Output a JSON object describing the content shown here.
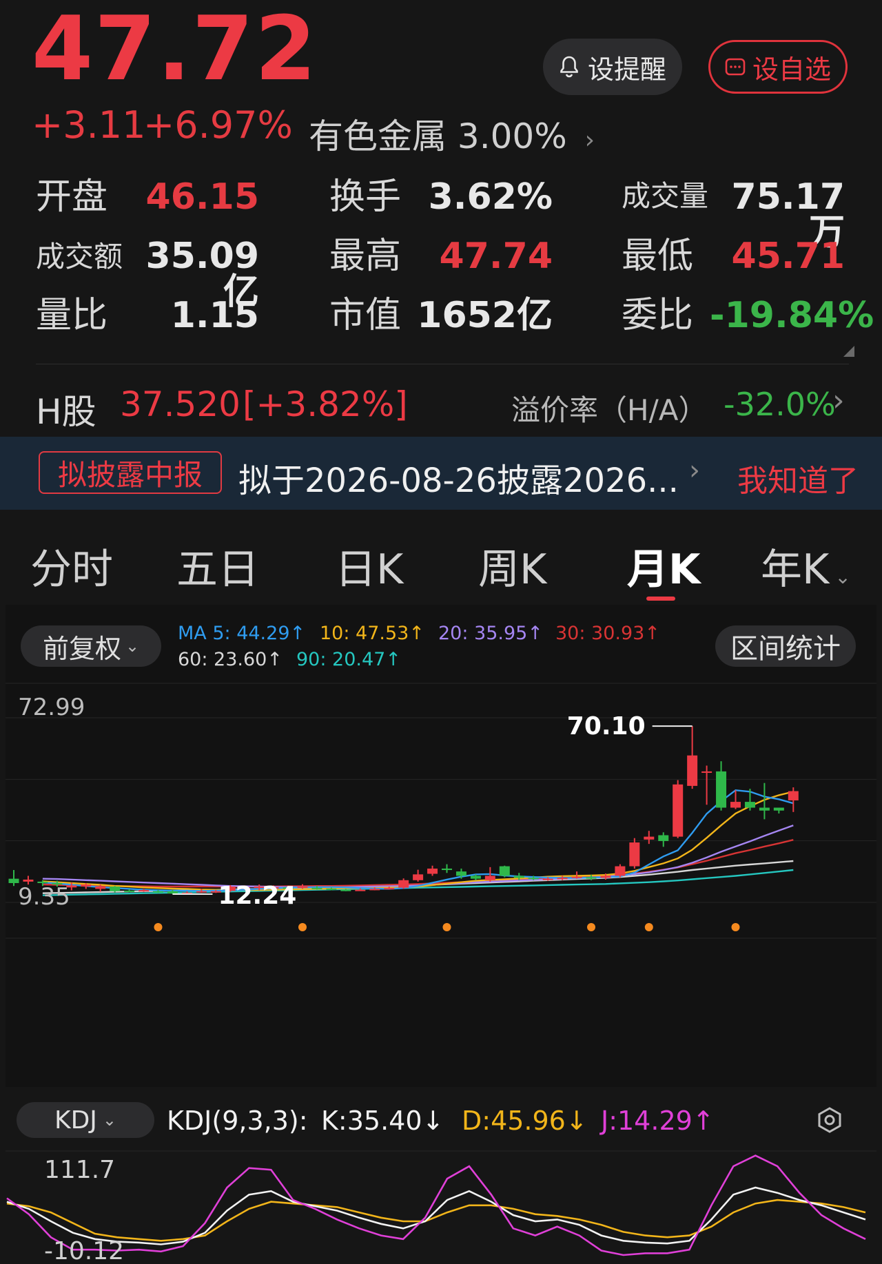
{
  "header": {
    "price": "47.72",
    "change": "+3.11",
    "change_pct": "+6.97%",
    "sector": "有色金属 3.00%",
    "alert_label": "设提醒",
    "watch_label": "设自选"
  },
  "stats": [
    {
      "label": "开盘",
      "value": "46.15",
      "color": "red"
    },
    {
      "label": "换手",
      "value": "3.62%",
      "color": "white"
    },
    {
      "label": "成交量",
      "value": "75.17万",
      "color": "white"
    },
    {
      "label": "成交额",
      "value": "35.09亿",
      "color": "white"
    },
    {
      "label": "最高",
      "value": "47.74",
      "color": "red"
    },
    {
      "label": "最低",
      "value": "45.71",
      "color": "red"
    },
    {
      "label": "量比",
      "value": "1.15",
      "color": "white"
    },
    {
      "label": "市值",
      "value": "1652亿",
      "color": "white"
    },
    {
      "label": "委比",
      "value": "-19.84%",
      "color": "green"
    }
  ],
  "hshare": {
    "label": "H股",
    "price": "37.520",
    "change": "[+3.82%]",
    "premium_label": "溢价率（H/A）",
    "premium_value": "-32.0%"
  },
  "banner": {
    "tag": "拟披露中报",
    "text": "拟于2026-08-26披露2026...",
    "ack": "我知道了"
  },
  "tabs": [
    {
      "label": "分时",
      "active": false
    },
    {
      "label": "五日",
      "active": false
    },
    {
      "label": "日K",
      "active": false
    },
    {
      "label": "周K",
      "active": false
    },
    {
      "label": "月K",
      "active": true
    },
    {
      "label": "年K",
      "active": false
    }
  ],
  "chart_toolbar": {
    "adjust_label": "前复权",
    "stats_label": "区间统计",
    "ma": [
      {
        "text": "MA 5: 44.29↑",
        "color": "#2f9cf0"
      },
      {
        "text": "10: 47.53↑",
        "color": "#f2b51a"
      },
      {
        "text": "20: 35.95↑",
        "color": "#a586f2"
      },
      {
        "text": "30: 30.93↑",
        "color": "#d83434"
      },
      {
        "text": "60: 23.60↑",
        "color": "#d8d8d8"
      },
      {
        "text": "90: 20.47↑",
        "color": "#25c7c0"
      }
    ]
  },
  "chart_data": {
    "type": "candlestick",
    "y_top_label": "72.99",
    "y_bottom_label": "9.35",
    "ylim": [
      9.35,
      72.99
    ],
    "high_marker": "70.10",
    "low_marker": "12.24",
    "candles": [
      [
        17.5,
        16.0,
        20.5,
        15.0
      ],
      [
        16.5,
        17.2,
        18.5,
        15.5
      ],
      [
        16.5,
        16.0,
        17.0,
        15.0
      ],
      [
        16.0,
        15.5,
        16.8,
        14.8
      ],
      [
        14.5,
        15.2,
        16.2,
        13.5
      ],
      [
        14.8,
        15.5,
        16.0,
        14.0
      ],
      [
        14.0,
        14.8,
        15.5,
        13.0
      ],
      [
        14.8,
        13.2,
        15.0,
        12.8
      ],
      [
        13.4,
        13.3,
        13.9,
        12.8
      ],
      [
        13.4,
        13.6,
        14.0,
        13.0
      ],
      [
        13.2,
        13.1,
        13.6,
        12.6
      ],
      [
        13.2,
        12.4,
        13.6,
        12.2
      ],
      [
        12.6,
        12.7,
        13.2,
        12.3
      ],
      [
        12.8,
        13.2,
        14.0,
        12.6
      ],
      [
        13.0,
        13.2,
        13.6,
        12.6
      ],
      [
        13.3,
        14.8,
        15.3,
        13.0
      ],
      [
        14.3,
        14.5,
        15.2,
        13.8
      ],
      [
        14.3,
        14.8,
        15.5,
        13.5
      ],
      [
        14.4,
        14.6,
        15.2,
        13.7
      ],
      [
        14.5,
        14.1,
        15.0,
        13.8
      ],
      [
        14.6,
        14.8,
        15.6,
        14.0
      ],
      [
        14.4,
        14.1,
        15.0,
        13.8
      ],
      [
        14.1,
        13.7,
        14.5,
        13.5
      ],
      [
        13.7,
        13.6,
        14.0,
        13.2
      ],
      [
        13.6,
        13.7,
        14.2,
        13.3
      ],
      [
        13.8,
        14.0,
        14.5,
        13.5
      ],
      [
        14.0,
        14.3,
        14.8,
        13.8
      ],
      [
        14.4,
        17.0,
        17.6,
        14.0
      ],
      [
        17.0,
        19.0,
        20.6,
        16.5
      ],
      [
        19.2,
        21.0,
        22.0,
        18.5
      ],
      [
        21.0,
        20.5,
        22.5,
        19.5
      ],
      [
        20.0,
        18.5,
        21.0,
        17.5
      ],
      [
        18.5,
        17.5,
        19.0,
        17.0
      ],
      [
        17.0,
        18.5,
        21.5,
        16.5
      ],
      [
        21.8,
        18.5,
        22.0,
        18.0
      ],
      [
        18.5,
        17.8,
        19.5,
        17.0
      ],
      [
        17.8,
        17.5,
        18.5,
        17.0
      ],
      [
        17.2,
        17.5,
        18.0,
        16.8
      ],
      [
        17.5,
        17.8,
        18.5,
        17.0
      ],
      [
        17.8,
        18.2,
        20.0,
        17.5
      ],
      [
        18.0,
        17.5,
        18.8,
        17.0
      ],
      [
        17.8,
        18.5,
        19.3,
        17.2
      ],
      [
        18.5,
        21.8,
        22.5,
        18.0
      ],
      [
        21.8,
        30.0,
        31.5,
        21.0
      ],
      [
        31.0,
        32.0,
        34.0,
        29.5
      ],
      [
        32.5,
        30.5,
        33.5,
        28.5
      ],
      [
        32.0,
        50.0,
        51.5,
        31.5
      ],
      [
        49.5,
        60.0,
        70.1,
        48.5
      ],
      [
        54.0,
        54.5,
        56.5,
        43.0
      ],
      [
        54.5,
        42.0,
        58.0,
        41.0
      ],
      [
        42.0,
        44.0,
        48.0,
        41.5
      ],
      [
        44.0,
        42.0,
        48.5,
        41.0
      ],
      [
        42.0,
        41.0,
        50.5,
        38.0
      ],
      [
        42.0,
        41.0,
        42.0,
        40.0
      ],
      [
        44.5,
        47.7,
        49.0,
        40.5
      ]
    ],
    "ma_series": {
      "ma5": [
        16.2,
        15.9,
        15.4,
        15.0,
        14.6,
        14.3,
        14.0,
        13.7,
        13.5,
        13.4,
        13.4,
        13.3,
        13.4,
        13.5,
        13.7,
        14.0,
        14.2,
        14.4,
        14.5,
        14.6,
        14.6,
        14.5,
        14.3,
        14.1,
        14.0,
        14.3,
        15.0,
        16.1,
        17.2,
        18.2,
        19.0,
        19.1,
        18.6,
        18.3,
        18.1,
        17.9,
        17.8,
        17.8,
        17.9,
        18.0,
        18.3,
        19.6,
        22.4,
        25.2,
        27.3,
        33.3,
        39.9,
        44.2,
        48.0,
        47.5,
        45.8,
        44.9,
        43.5
      ],
      "ma10": [
        16.6,
        16.3,
        16.0,
        15.7,
        15.4,
        15.0,
        14.8,
        14.5,
        14.3,
        14.1,
        14.0,
        13.8,
        13.7,
        13.6,
        13.6,
        13.6,
        13.7,
        13.8,
        13.9,
        14.0,
        14.1,
        14.2,
        14.3,
        14.3,
        14.4,
        14.5,
        14.8,
        15.3,
        15.8,
        16.3,
        16.8,
        17.1,
        17.3,
        17.6,
        17.9,
        18.2,
        18.4,
        18.5,
        18.6,
        18.8,
        19.3,
        20.2,
        21.5,
        22.8,
        24.5,
        27.5,
        31.6,
        35.9,
        40.0,
        42.5,
        44.7,
        46.3,
        47.5
      ],
      "ma20": [
        17.5,
        17.4,
        17.2,
        17.0,
        16.8,
        16.6,
        16.4,
        16.2,
        16.0,
        15.8,
        15.6,
        15.4,
        15.2,
        15.0,
        14.9,
        14.8,
        14.7,
        14.6,
        14.6,
        14.6,
        14.6,
        14.6,
        14.7,
        14.8,
        14.9,
        15.0,
        15.2,
        15.4,
        15.7,
        16.0,
        16.3,
        16.5,
        16.7,
        16.9,
        17.1,
        17.3,
        17.5,
        17.7,
        17.9,
        18.2,
        18.6,
        19.1,
        19.7,
        20.5,
        21.5,
        23.0,
        24.8,
        26.8,
        28.6,
        30.4,
        32.3,
        34.1,
        35.9
      ],
      "ma30": [
        15.5,
        15.4,
        15.3,
        15.2,
        15.1,
        15.0,
        14.9,
        14.9,
        14.8,
        14.8,
        14.8,
        14.8,
        14.8,
        14.8,
        14.8,
        14.8,
        14.8,
        14.9,
        14.9,
        15.0,
        15.0,
        15.1,
        15.2,
        15.3,
        15.4,
        15.5,
        15.7,
        15.9,
        16.1,
        16.3,
        16.5,
        16.7,
        16.9,
        17.1,
        17.3,
        17.5,
        17.7,
        17.9,
        18.1,
        18.4,
        18.8,
        19.3,
        19.9,
        20.6,
        21.4,
        22.5,
        23.7,
        25.0,
        26.3,
        27.4,
        28.6,
        29.7,
        30.9
      ],
      "ma60": [
        12.5,
        12.6,
        12.7,
        12.8,
        12.9,
        13.0,
        13.1,
        13.2,
        13.3,
        13.4,
        13.5,
        13.6,
        13.7,
        13.8,
        13.9,
        14.0,
        14.1,
        14.2,
        14.3,
        14.4,
        14.5,
        14.6,
        14.7,
        14.8,
        14.9,
        15.0,
        15.2,
        15.4,
        15.6,
        15.8,
        16.0,
        16.2,
        16.4,
        16.6,
        16.8,
        17.0,
        17.2,
        17.4,
        17.6,
        17.8,
        18.1,
        18.5,
        18.9,
        19.4,
        19.9,
        20.5,
        21.0,
        21.5,
        22.0,
        22.4,
        22.8,
        23.2,
        23.6
      ],
      "ma90": [
        11.8,
        11.9,
        12.0,
        12.1,
        12.2,
        12.3,
        12.4,
        12.5,
        12.6,
        12.7,
        12.8,
        12.9,
        13.0,
        13.1,
        13.2,
        13.3,
        13.4,
        13.5,
        13.6,
        13.7,
        13.8,
        13.9,
        14.0,
        14.1,
        14.2,
        14.3,
        14.4,
        14.5,
        14.6,
        14.7,
        14.8,
        14.9,
        15.0,
        15.1,
        15.2,
        15.3,
        15.4,
        15.5,
        15.6,
        15.7,
        15.9,
        16.1,
        16.3,
        16.6,
        16.9,
        17.3,
        17.7,
        18.1,
        18.5,
        19.0,
        19.5,
        20.0,
        20.5
      ]
    },
    "event_dot_indices": [
      10,
      20,
      30,
      40,
      44,
      50
    ]
  },
  "kdj": {
    "selector_label": "KDJ",
    "params": "KDJ(9,3,3):",
    "k_text": "K:35.40↓",
    "d_text": "D:45.96↓",
    "j_text": "J:14.29↑",
    "y_top_label": "111.7",
    "y_bottom_label": "-10.12",
    "ylim": [
      -10.12,
      111.7
    ],
    "k": [
      60,
      52,
      38,
      25,
      18,
      15,
      14,
      12,
      15,
      25,
      50,
      68,
      72,
      60,
      55,
      50,
      42,
      35,
      30,
      38,
      62,
      72,
      60,
      45,
      38,
      40,
      34,
      22,
      16,
      14,
      13,
      16,
      40,
      68,
      76,
      70,
      62,
      56,
      48,
      40
    ],
    "d": [
      58,
      55,
      48,
      36,
      24,
      20,
      18,
      16,
      18,
      22,
      38,
      52,
      60,
      58,
      56,
      54,
      48,
      42,
      38,
      38,
      48,
      56,
      56,
      52,
      46,
      44,
      40,
      34,
      26,
      22,
      20,
      22,
      32,
      48,
      58,
      62,
      60,
      58,
      54,
      48
    ],
    "j": [
      64,
      46,
      20,
      6,
      6,
      5,
      6,
      4,
      10,
      36,
      76,
      98,
      96,
      62,
      52,
      40,
      30,
      22,
      18,
      42,
      86,
      100,
      68,
      30,
      22,
      32,
      22,
      5,
      0,
      2,
      2,
      6,
      56,
      100,
      112,
      100,
      70,
      45,
      30,
      18
    ],
    "colors": {
      "k": "#f2f2f2",
      "d": "#f2b51a",
      "j": "#e040d8"
    }
  },
  "colors": {
    "up": "#ec3a44",
    "down": "#2fb84a",
    "accent": "#ec3a44",
    "event_dot": "#f58a1f"
  }
}
